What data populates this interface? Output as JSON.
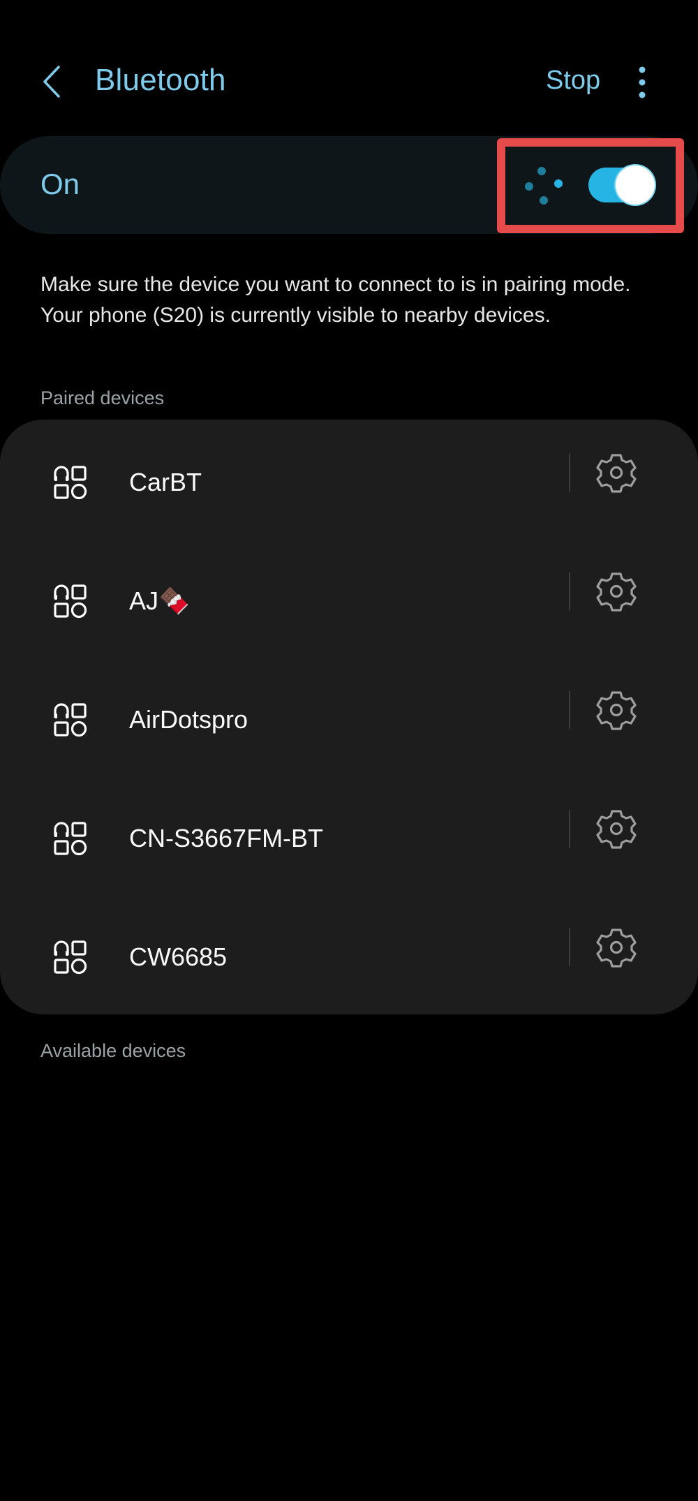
{
  "header": {
    "back_icon": "chevron-left-icon",
    "title": "Bluetooth",
    "stop_label": "Stop",
    "more_icon": "more-vert-icon"
  },
  "master_switch": {
    "label": "On",
    "state": true,
    "scanning_icon": "scanning-dots-icon",
    "accent_color": "#25b4e3",
    "highlight_color": "#e64b4b"
  },
  "description": {
    "line1": "Make sure the device you want to connect to is in pairing mode.",
    "line2": "Your phone (S20) is currently visible to nearby devices."
  },
  "paired_section": {
    "title": "Paired devices",
    "devices": [
      {
        "name": "CarBT",
        "icon": "generic-device-icon",
        "settings_icon": "gear-icon"
      },
      {
        "name": "AJ🍫",
        "icon": "generic-device-icon",
        "settings_icon": "gear-icon"
      },
      {
        "name": "AirDotspro",
        "icon": "generic-device-icon",
        "settings_icon": "gear-icon"
      },
      {
        "name": "CN-S3667FM-BT",
        "icon": "generic-device-icon",
        "settings_icon": "gear-icon"
      },
      {
        "name": "CW6685",
        "icon": "generic-device-icon",
        "settings_icon": "gear-icon"
      }
    ]
  },
  "available_section": {
    "title": "Available devices"
  }
}
